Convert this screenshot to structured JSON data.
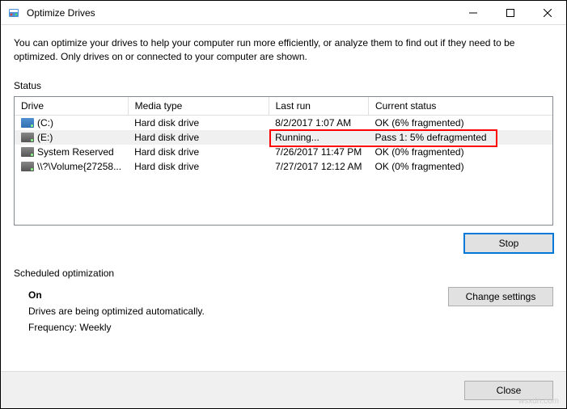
{
  "titlebar": {
    "title": "Optimize Drives"
  },
  "description": "You can optimize your drives to help your computer run more efficiently, or analyze them to find out if they need to be optimized. Only drives on or connected to your computer are shown.",
  "status_label": "Status",
  "columns": {
    "drive": "Drive",
    "media": "Media type",
    "lastrun": "Last run",
    "status": "Current status"
  },
  "drives": [
    {
      "name": "(C:)",
      "icon": "c",
      "media": "Hard disk drive",
      "lastrun": "8/2/2017 1:07 AM",
      "status": "OK (6% fragmented)"
    },
    {
      "name": "(E:)",
      "icon": "hdd",
      "media": "Hard disk drive",
      "lastrun": "Running...",
      "status": "Pass 1: 5% defragmented",
      "highlighted": true
    },
    {
      "name": "System Reserved",
      "icon": "hdd",
      "media": "Hard disk drive",
      "lastrun": "7/26/2017 11:47 PM",
      "status": "OK (0% fragmented)"
    },
    {
      "name": "\\\\?\\Volume{27258...",
      "icon": "hdd",
      "media": "Hard disk drive",
      "lastrun": "7/27/2017 12:12 AM",
      "status": "OK (0% fragmented)"
    }
  ],
  "buttons": {
    "stop": "Stop",
    "change_settings": "Change settings",
    "close": "Close"
  },
  "scheduled": {
    "label": "Scheduled optimization",
    "on": "On",
    "desc": "Drives are being optimized automatically.",
    "freq": "Frequency: Weekly"
  },
  "watermark": "wsxdn.com"
}
